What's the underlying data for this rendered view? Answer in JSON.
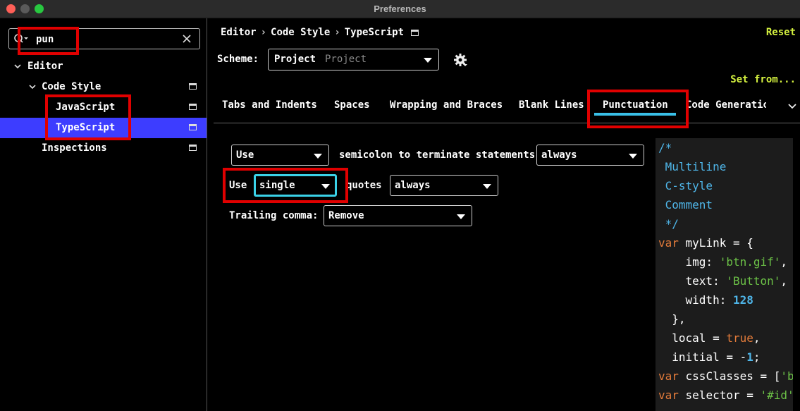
{
  "window": {
    "title": "Preferences"
  },
  "sidebar": {
    "search": {
      "value": "pun"
    },
    "tree": [
      {
        "label": "Editor"
      },
      {
        "label": "Code Style"
      },
      {
        "label": "JavaScript"
      },
      {
        "label": "TypeScript",
        "selected": true
      },
      {
        "label": "Inspections"
      }
    ]
  },
  "header": {
    "breadcrumb": [
      "Editor",
      "Code Style",
      "TypeScript"
    ],
    "separator": "›",
    "reset": "Reset",
    "scheme_label": "Scheme:",
    "scheme_value": "Project",
    "scheme_type": "Project",
    "set_from": "Set from..."
  },
  "tabs": [
    {
      "label": "Tabs and Indents"
    },
    {
      "label": "Spaces"
    },
    {
      "label": "Wrapping and Braces"
    },
    {
      "label": "Blank Lines"
    },
    {
      "label": "Punctuation",
      "active": true
    },
    {
      "label": "Code Generatio"
    }
  ],
  "form": {
    "row1": {
      "select1": "Use",
      "text": "semicolon to terminate statements",
      "select2": "always"
    },
    "row2": {
      "label": "Use",
      "select1": "single",
      "text": "quotes",
      "select2": "always"
    },
    "row3": {
      "label": "Trailing comma:",
      "select": "Remove"
    }
  },
  "preview": {
    "lines": [
      "/*",
      " Multiline",
      " C-style",
      " Comment",
      " */",
      "var myLink = {",
      "    img: 'btn.gif',",
      "    text: 'Button',",
      "    width: 128",
      "  },",
      "  local = true,",
      "  initial = -1;",
      "var cssClasses = ['bo",
      "var selector = '#id';"
    ]
  },
  "colors": {
    "accent_link": "#d4f13f",
    "selected_row": "#3d3dff",
    "tab_underline": "#39c0e8",
    "highlight": "#e00000",
    "keyword": "#e37b3a",
    "string": "#6cc247",
    "comment": "#4fb6e9"
  }
}
